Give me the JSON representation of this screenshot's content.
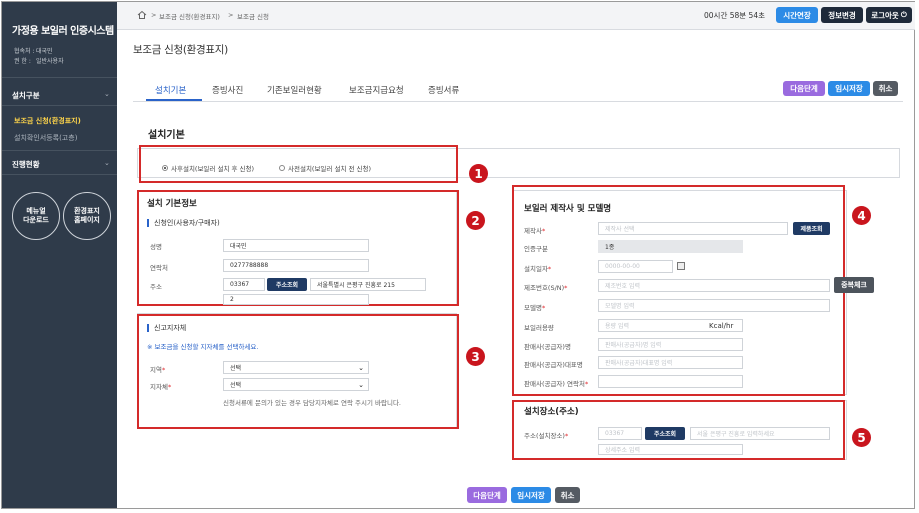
{
  "app": {
    "title": "가정용 보일러 인증시스템"
  },
  "user": {
    "org_label": "협속처 :",
    "org_value": "대국민",
    "role_label": "권  한 :",
    "role_value": "일반사용자"
  },
  "sidebar": {
    "menus": [
      {
        "label": "설치구분"
      },
      {
        "label": "진행현황"
      }
    ],
    "subs": [
      {
        "label": "보조금 신청(환경표지)"
      },
      {
        "label": "설치확인서등록(고층)"
      }
    ],
    "circle_manual_line1": "메뉴얼",
    "circle_manual_line2": "다운로드",
    "circle_home_line1": "환경표지",
    "circle_home_line2": "홈페이지"
  },
  "topbar": {
    "crumbs": [
      ">",
      "보조금 신청(환경표지)",
      ">",
      "보조금 신청"
    ],
    "timer": "00시간 58분 54초",
    "extend": "시간연장",
    "info": "정보변경",
    "logout": "로그아웃"
  },
  "page": {
    "title": "보조금 신청(환경표지)",
    "section": "설치기본"
  },
  "tabs": [
    "설치기본",
    "증빙사진",
    "기존보일러현황",
    "보조금지급요청",
    "증빙서류"
  ],
  "actions": {
    "next": "다음단계",
    "temp_save": "임시저장",
    "cancel": "취소"
  },
  "install_type": {
    "options": [
      "사후설치(보일러 설치 후 신청)",
      "사전설치(보일러 설치 전 신청)"
    ]
  },
  "basic_info": {
    "title": "설치 기본정보",
    "applicant_title": "신청인(사용자/구매자)",
    "name_label": "성명",
    "name_value": "대국민",
    "phone_label": "연락처",
    "phone_value": "0277788888",
    "address_label": "주소",
    "zip": "03367",
    "address_search": "주소조회",
    "address_value": "서울특별시 은평구 진흥로 215",
    "address_detail": "2"
  },
  "local_gov": {
    "title": "신고지자체",
    "note": "※ 보조금을 신청할 지자체를 선택하세요.",
    "region_label": "지역",
    "region_value": "선택",
    "gov_label": "지자체",
    "gov_value": "선택",
    "help": "신청서류에 문의가 있는 경우 담당지자체로 연락 주시기 바랍니다."
  },
  "boiler": {
    "title": "보일러 제작사 및 모델명",
    "maker_label": "제작사",
    "maker_ph": "제작사 선택",
    "product_search": "제품조회",
    "cert_label": "인증구분",
    "cert_value": "1종",
    "date_label": "설치일자",
    "date_ph": "0000-00-00",
    "serial_label": "제조번호(S/N)",
    "serial_ph": "제조번호 입력",
    "dup_check": "중복체크",
    "model_label": "모델명",
    "model_ph": "모델명 입력",
    "capacity_label": "보일러용량",
    "capacity_ph": "용량 입력",
    "capacity_unit": "Kcal/hr",
    "seller_label": "판매사(공급자)명",
    "seller_ph": "판매사(공급자)명 입력",
    "rep_label": "판매사(공급자)대표명",
    "rep_ph": "판매사(공급자)대표명 입력",
    "contact_label": "판매사(공급자) 연락처",
    "contact_ph": ""
  },
  "install_place": {
    "title": "설치장소(주소)",
    "address_label": "주소(설치장소)",
    "zip_ph": "03367",
    "address_search": "주소조회",
    "address_ph": "서울 은평구 진흥로 입력하세요",
    "detail_ph": "상세주소 입력"
  },
  "badges": [
    "1",
    "2",
    "3",
    "4",
    "5"
  ],
  "colors": {
    "sidebar": "#2f3b4a",
    "accent_blue": "#2a63c9",
    "highlight_red": "#d42a2a"
  }
}
